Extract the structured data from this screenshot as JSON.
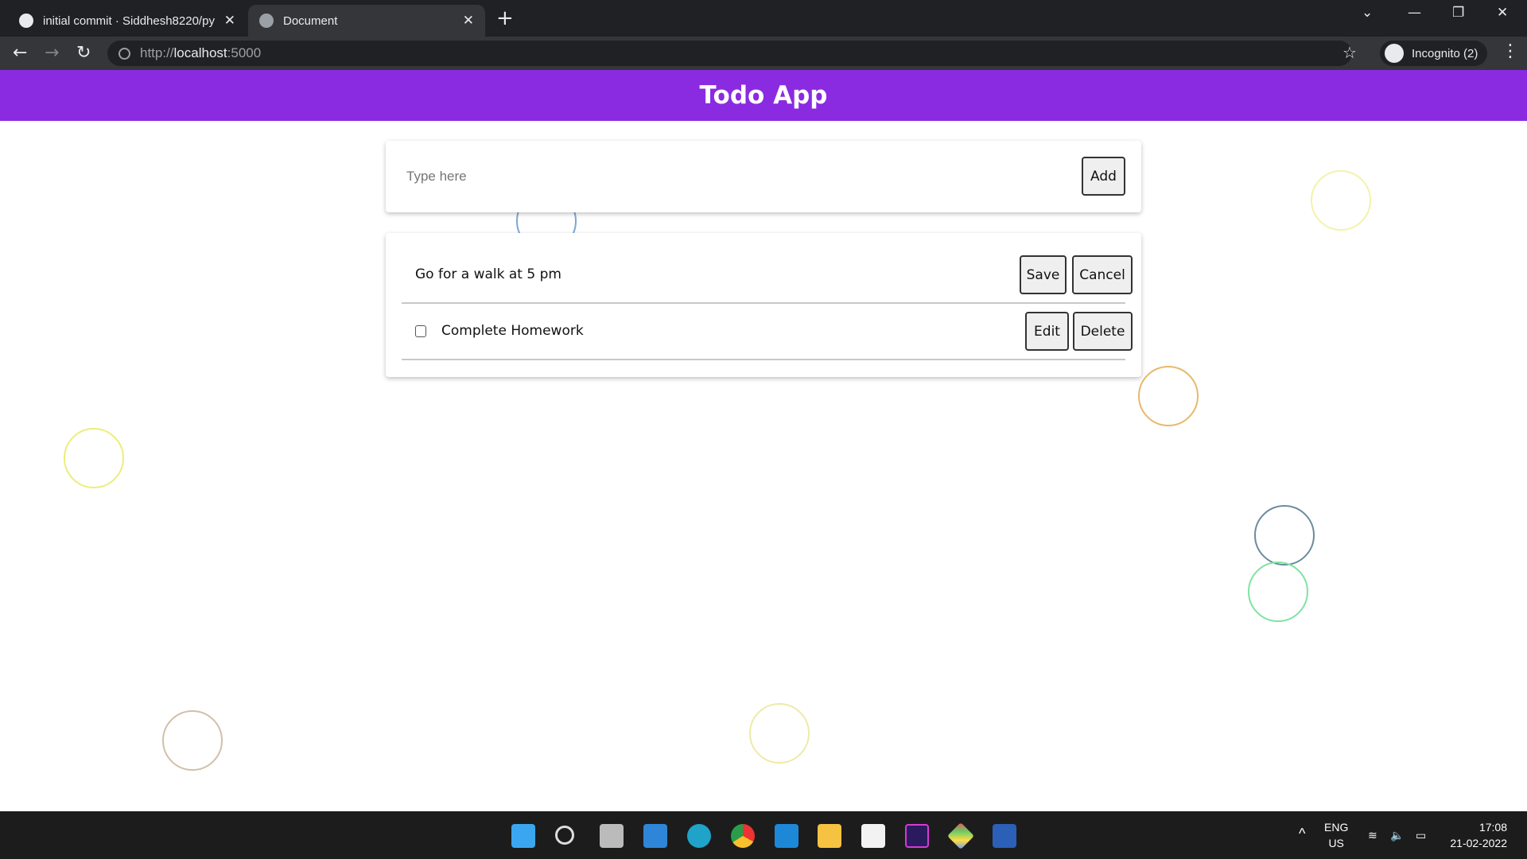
{
  "browser": {
    "tabs": [
      {
        "title": "initial commit · Siddhesh8220/py",
        "icon": "github-icon"
      },
      {
        "title": "Document",
        "icon": "globe-icon"
      }
    ],
    "url_scheme": "http://",
    "url_host": "localhost",
    "url_port": ":5000",
    "profile_label": "Incognito (2)"
  },
  "app": {
    "title": "Todo App",
    "accent": "#8a2be2",
    "input_placeholder": "Type here",
    "input_value": "",
    "add_label": "Add",
    "todos": [
      {
        "text": "Go for a walk at 5 pm",
        "editing": true,
        "primary_label": "Save",
        "secondary_label": "Cancel"
      },
      {
        "text": "Complete Homework",
        "editing": false,
        "checked": false,
        "primary_label": "Edit",
        "secondary_label": "Delete"
      }
    ]
  },
  "taskbar": {
    "apps": [
      "start",
      "search",
      "task-view",
      "widgets",
      "edge",
      "chrome",
      "vscode",
      "file-explorer",
      "store",
      "intellij",
      "git",
      "word"
    ],
    "lang_line1": "ENG",
    "lang_line2": "US",
    "time": "17:08",
    "date": "21-02-2022"
  }
}
